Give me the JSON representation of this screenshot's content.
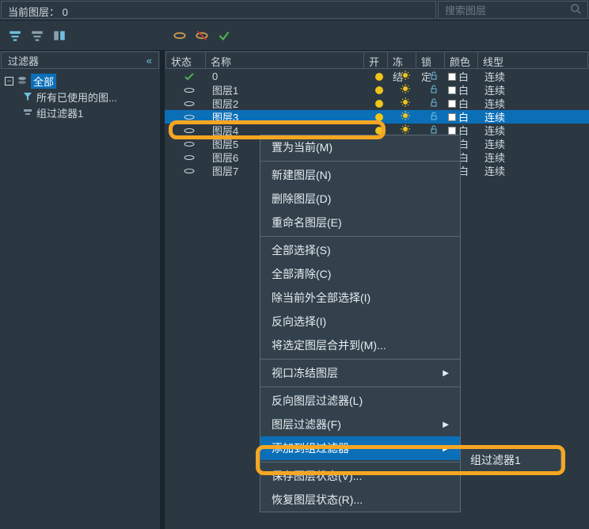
{
  "header": {
    "current_layer_label": "当前图层：",
    "current_layer_value": "0",
    "search_placeholder": "搜索图层"
  },
  "sidebar": {
    "title": "过滤器",
    "collapse_glyph": "«",
    "root": "全部",
    "children": [
      {
        "label": "所有已使用的图..."
      },
      {
        "label": "组过滤器1"
      }
    ]
  },
  "columns": {
    "state": "状态",
    "name": "名称",
    "on": "开",
    "freeze": "冻结",
    "lock": "锁定",
    "color": "颜色",
    "linetype": "线型"
  },
  "layers": [
    {
      "state": "current",
      "name": "0",
      "color_name": "白",
      "linetype": "连续",
      "selected": false
    },
    {
      "state": "normal",
      "name": "图层1",
      "color_name": "白",
      "linetype": "连续",
      "selected": false
    },
    {
      "state": "normal",
      "name": "图层2",
      "color_name": "白",
      "linetype": "连续",
      "selected": false
    },
    {
      "state": "normal",
      "name": "图层3",
      "color_name": "白",
      "linetype": "连续",
      "selected": true
    },
    {
      "state": "normal",
      "name": "图层4",
      "color_name": "白",
      "linetype": "连续",
      "selected": false
    },
    {
      "state": "normal",
      "name": "图层5",
      "color_name": "白",
      "linetype": "连续",
      "selected": false
    },
    {
      "state": "normal",
      "name": "图层6",
      "color_name": "白",
      "linetype": "连续",
      "selected": false
    },
    {
      "state": "normal",
      "name": "图层7",
      "color_name": "白",
      "linetype": "连续",
      "selected": false
    }
  ],
  "context_menu": {
    "items": [
      {
        "label": "置为当前(M)"
      },
      {
        "sep": true
      },
      {
        "label": "新建图层(N)"
      },
      {
        "label": "删除图层(D)"
      },
      {
        "label": "重命名图层(E)"
      },
      {
        "sep": true
      },
      {
        "label": "全部选择(S)"
      },
      {
        "label": "全部清除(C)"
      },
      {
        "label": "除当前外全部选择(I)"
      },
      {
        "label": "反向选择(I)"
      },
      {
        "label": "将选定图层合并到(M)..."
      },
      {
        "sep": true
      },
      {
        "label": "视口冻结图层",
        "submenu": true
      },
      {
        "sep": true
      },
      {
        "label": "反向图层过滤器(L)"
      },
      {
        "label": "图层过滤器(F)",
        "submenu": true
      },
      {
        "label": "添加到组过滤器",
        "submenu": true,
        "highlighted": true
      },
      {
        "sep": true
      },
      {
        "label": "保存图层状态(V)..."
      },
      {
        "label": "恢复图层状态(R)..."
      }
    ],
    "submenu_label": "组过滤器1"
  }
}
